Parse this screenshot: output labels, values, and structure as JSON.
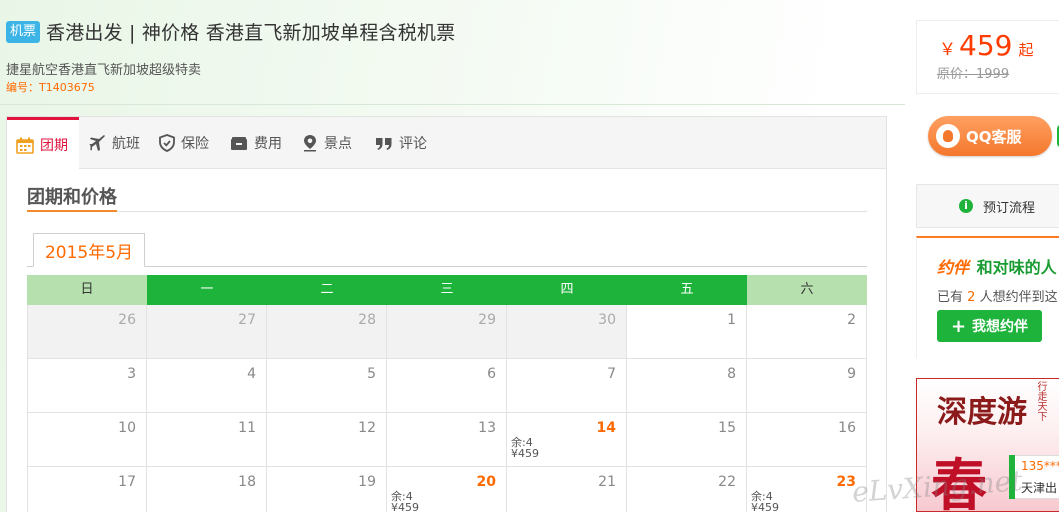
{
  "header": {
    "badge": "机票",
    "title": "香港出发 | 神价格 香港直飞新加坡单程含税机票",
    "subtitle": "捷星航空香港直飞新加坡超级特卖",
    "code": "编号：T1403675"
  },
  "price": {
    "currency": "￥",
    "amount": "459",
    "suffix": "起",
    "original": "原价：1999"
  },
  "sidebar": {
    "qq_label": "QQ客服",
    "order_flow": "预订流程",
    "yueban": {
      "logo": "约伴",
      "title": "和对味的人",
      "text_prefix": "已有",
      "count": "2",
      "text_suffix": "人想约伴到这",
      "button": "我想约伴"
    },
    "ad": {
      "title": "深度游",
      "side": "行走天下",
      "big": "春",
      "chat_number": "135***",
      "chat_city": "天津出"
    }
  },
  "tabs": [
    {
      "label": "团期",
      "icon": "calendar-icon",
      "active": true
    },
    {
      "label": "航班",
      "icon": "plane-icon"
    },
    {
      "label": "保险",
      "icon": "shield-icon"
    },
    {
      "label": "费用",
      "icon": "wallet-icon"
    },
    {
      "label": "景点",
      "icon": "location-pin-icon"
    },
    {
      "label": "评论",
      "icon": "quote-icon"
    }
  ],
  "section_title": "团期和价格",
  "calendar": {
    "month": "2015年5月",
    "weekdays": [
      "日",
      "一",
      "二",
      "三",
      "四",
      "五",
      "六"
    ],
    "weeks": [
      [
        {
          "d": "26",
          "other": true
        },
        {
          "d": "27",
          "other": true
        },
        {
          "d": "28",
          "other": true
        },
        {
          "d": "29",
          "other": true
        },
        {
          "d": "30",
          "other": true
        },
        {
          "d": "1"
        },
        {
          "d": "2"
        }
      ],
      [
        {
          "d": "3"
        },
        {
          "d": "4"
        },
        {
          "d": "5"
        },
        {
          "d": "6"
        },
        {
          "d": "7"
        },
        {
          "d": "8"
        },
        {
          "d": "9"
        }
      ],
      [
        {
          "d": "10"
        },
        {
          "d": "11"
        },
        {
          "d": "12"
        },
        {
          "d": "13"
        },
        {
          "d": "14",
          "rem": "余:4",
          "price": "¥459"
        },
        {
          "d": "15"
        },
        {
          "d": "16"
        }
      ],
      [
        {
          "d": "17"
        },
        {
          "d": "18"
        },
        {
          "d": "19"
        },
        {
          "d": "20",
          "rem": "余:4",
          "price": "¥459"
        },
        {
          "d": "21"
        },
        {
          "d": "22"
        },
        {
          "d": "23",
          "rem": "余:4",
          "price": "¥459"
        }
      ]
    ]
  },
  "watermark": "eLvXing.net",
  "colors": {
    "green": "#1eb33a",
    "orange": "#ff6a00",
    "red": "#e0143c",
    "badge_blue": "#3db4e6"
  }
}
